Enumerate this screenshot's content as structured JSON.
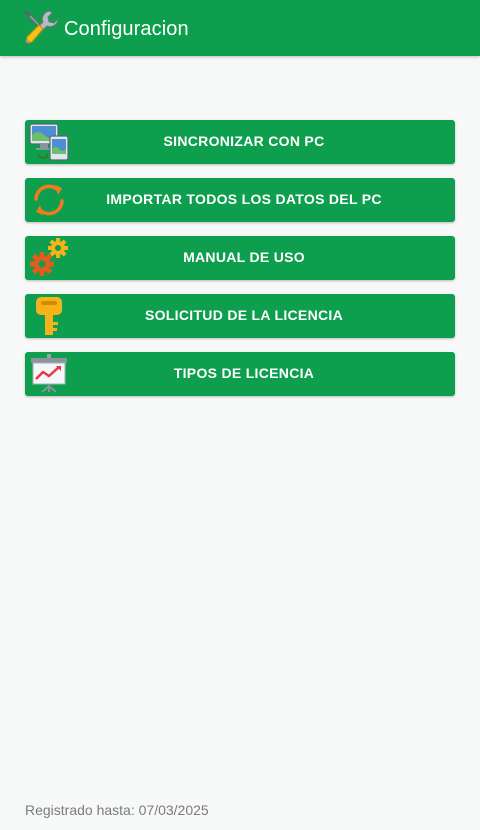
{
  "header": {
    "title": "Configuracion",
    "icon": "tools-icon",
    "background_color": "#0e9f4e"
  },
  "menu": {
    "items": [
      {
        "label": "SINCRONIZAR CON PC",
        "icon": "computer-sync-icon"
      },
      {
        "label": "IMPORTAR TODOS LOS DATOS DEL PC",
        "icon": "refresh-arrows-icon"
      },
      {
        "label": "MANUAL DE USO",
        "icon": "gears-icon"
      },
      {
        "label": "SOLICITUD DE LA LICENCIA",
        "icon": "key-icon"
      },
      {
        "label": "TIPOS DE LICENCIA",
        "icon": "presentation-chart-icon"
      }
    ],
    "button_color": "#0e9f4e"
  },
  "footer": {
    "text": "Registrado hasta: 07/03/2025"
  }
}
